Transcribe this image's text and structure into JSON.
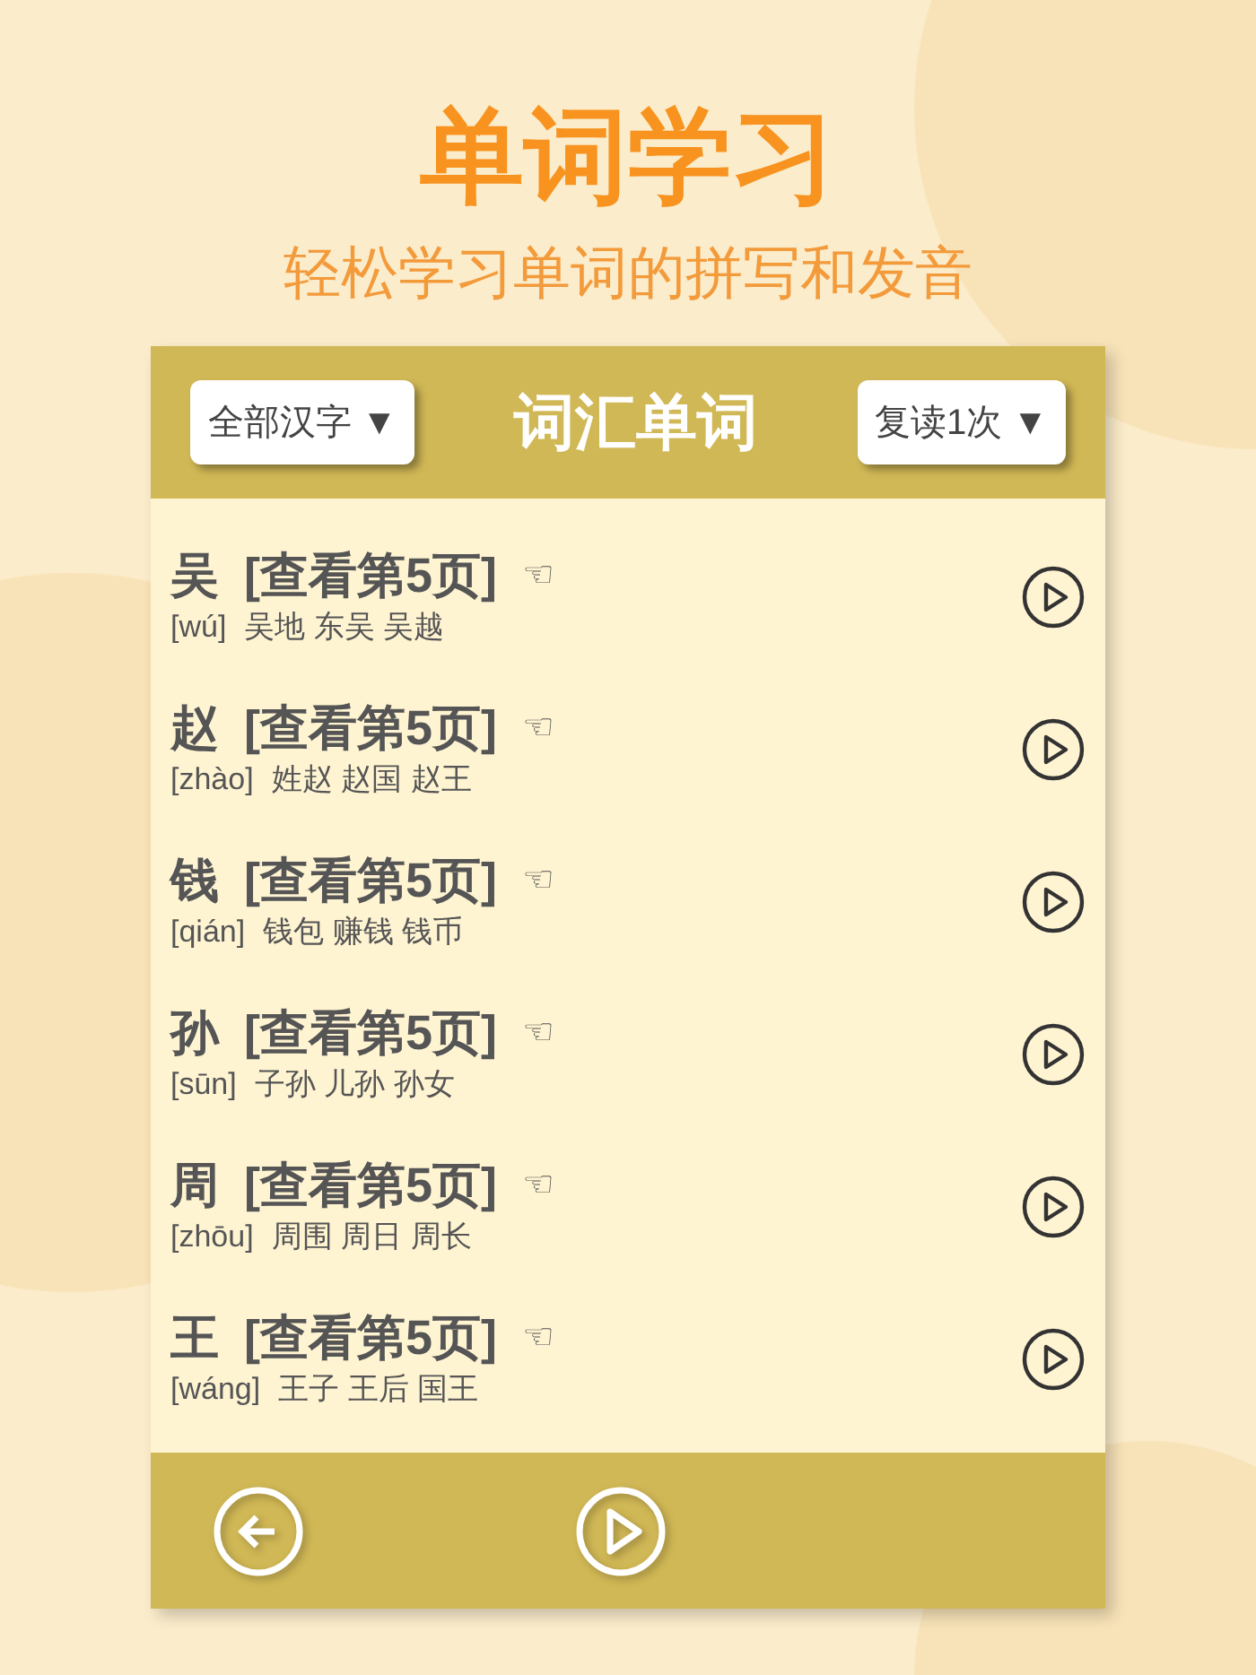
{
  "headline": "单词学习",
  "subtitle": "轻松学习单词的拼写和发音",
  "header": {
    "filter": "全部汉字 ▼",
    "title": "词汇单词",
    "repeat": "复读1次 ▼"
  },
  "words": [
    {
      "character": "吴",
      "page_link": "[查看第5页]",
      "pointer": "☜",
      "pinyin": "[wú]",
      "examples": "吴地 东吴 吴越"
    },
    {
      "character": "赵",
      "page_link": "[查看第5页]",
      "pointer": "☜",
      "pinyin": "[zhào]",
      "examples": "姓赵 赵国 赵王"
    },
    {
      "character": "钱",
      "page_link": "[查看第5页]",
      "pointer": "☜",
      "pinyin": "[qián]",
      "examples": "钱包 赚钱 钱币"
    },
    {
      "character": "孙",
      "page_link": "[查看第5页]",
      "pointer": "☜",
      "pinyin": "[sūn]",
      "examples": "子孙 儿孙 孙女"
    },
    {
      "character": "周",
      "page_link": "[查看第5页]",
      "pointer": "☜",
      "pinyin": "[zhōu]",
      "examples": "周围 周日 周长"
    },
    {
      "character": "王",
      "page_link": "[查看第5页]",
      "pointer": "☜",
      "pinyin": "[wáng]",
      "examples": "王子 王后 国王"
    }
  ]
}
